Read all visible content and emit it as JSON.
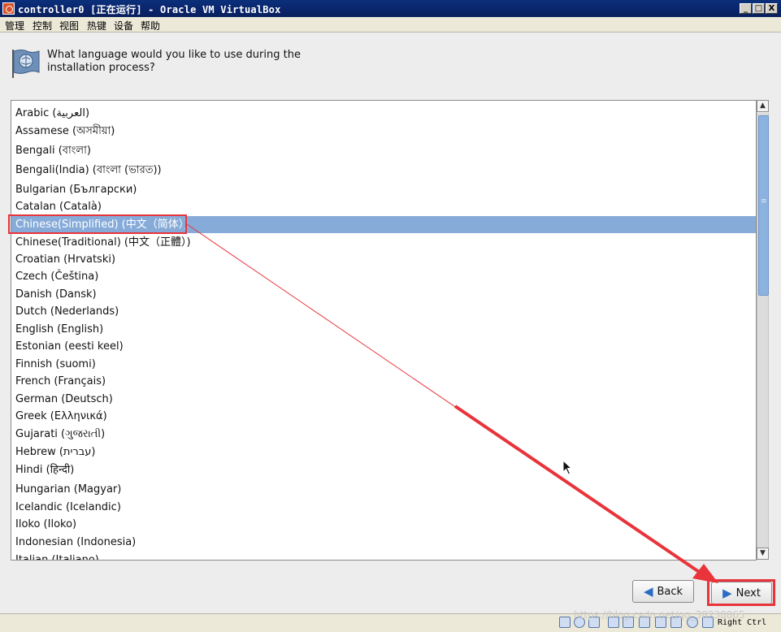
{
  "window": {
    "title": "controller0 [正在运行] - Oracle VM VirtualBox",
    "minimize": "_",
    "maximize": "□",
    "close": "X"
  },
  "menu": [
    "管理",
    "控制",
    "视图",
    "热键",
    "设备",
    "帮助"
  ],
  "installer": {
    "question_line1": "What language would you like to use during the",
    "question_line2": "installation process?",
    "languages": [
      "Arabic (العربية)",
      "Assamese (অসমীয়া)",
      "Bengali (বাংলা)",
      "Bengali(India) (বাংলা (ভারত))",
      "Bulgarian (Български)",
      "Catalan (Català)",
      "Chinese(Simplified) (中文（简体）)",
      "Chinese(Traditional) (中文（正體）)",
      "Croatian (Hrvatski)",
      "Czech (Čeština)",
      "Danish (Dansk)",
      "Dutch (Nederlands)",
      "English (English)",
      "Estonian (eesti keel)",
      "Finnish (suomi)",
      "French (Français)",
      "German (Deutsch)",
      "Greek (Ελληνικά)",
      "Gujarati (ગુજરાતી)",
      "Hebrew (עברית)",
      "Hindi (हिन्दी)",
      "Hungarian (Magyar)",
      "Icelandic (Icelandic)",
      "Iloko (Iloko)",
      "Indonesian (Indonesia)",
      "Italian (Italiano)"
    ],
    "selected_index": 6,
    "back_label": "Back",
    "next_label": "Next"
  },
  "statusbar": {
    "host_key": "Right Ctrl",
    "watermark": "https://blog.csdn.net/qq_38238865"
  },
  "colors": {
    "selection": "#86abd9",
    "annotation": "#e8343a",
    "titlebar": "#0a246a"
  }
}
